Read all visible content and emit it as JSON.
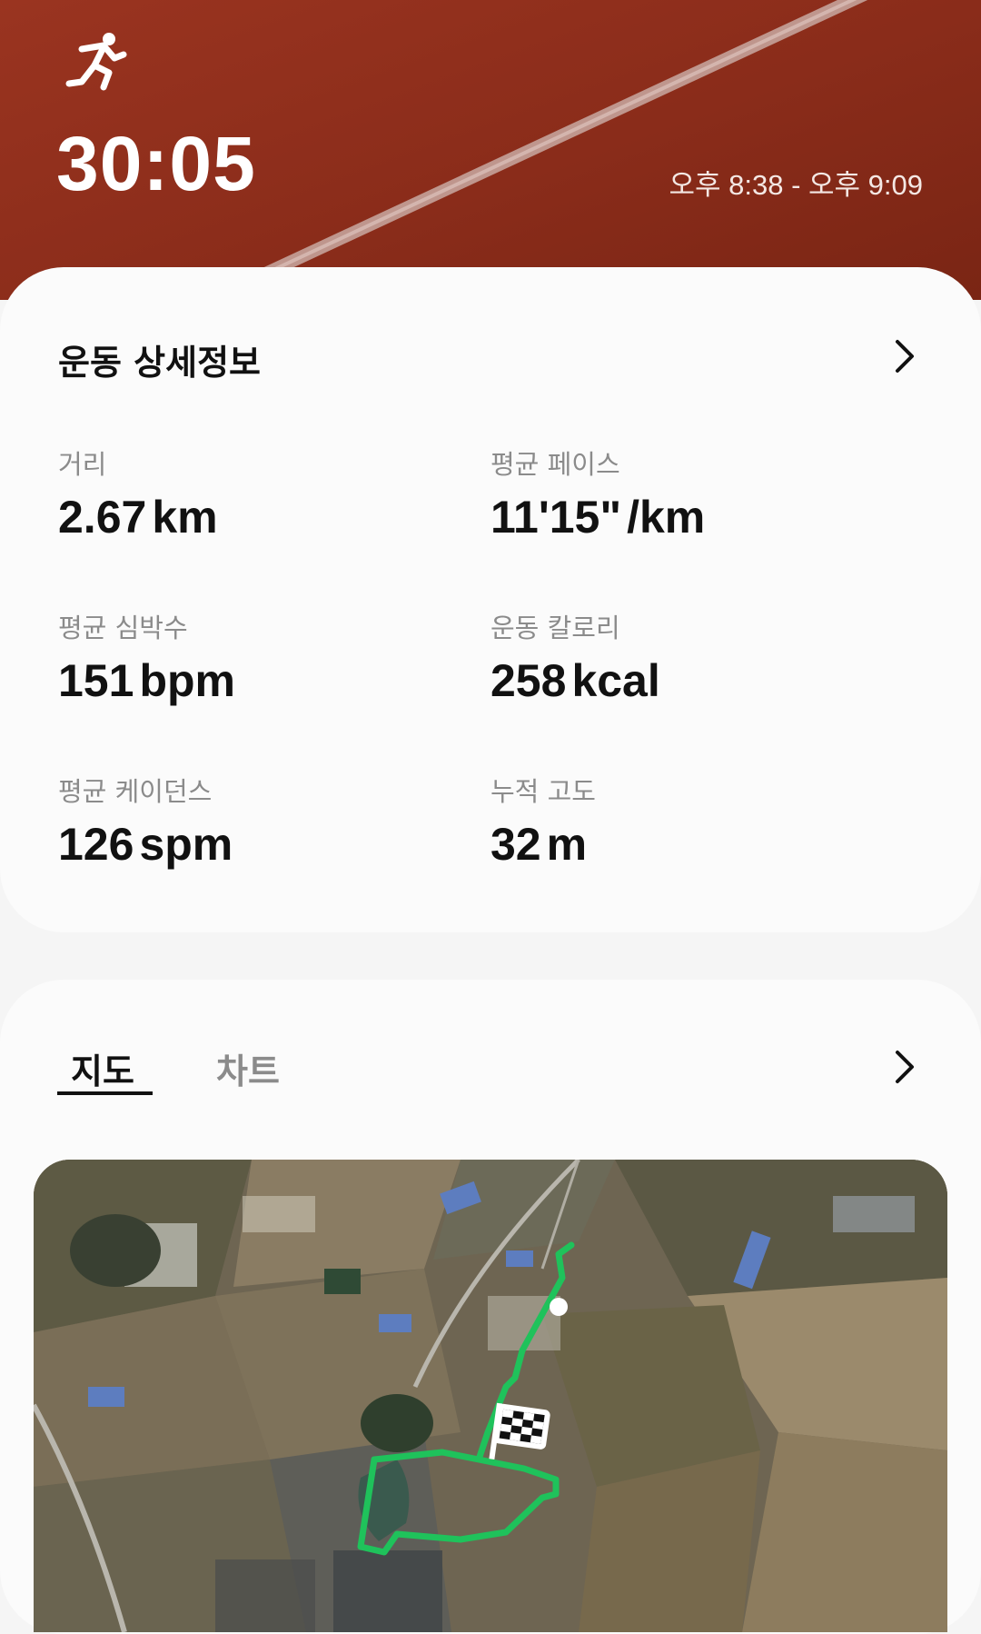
{
  "header": {
    "duration": "30:05",
    "time_range": "오후 8:38 - 오후 9:09",
    "icon": "running-person-icon",
    "background_color": "#8e2e1b"
  },
  "details": {
    "title": "운동 상세정보",
    "stats": [
      {
        "label": "거리",
        "value": "2.67",
        "unit": "km"
      },
      {
        "label": "평균 페이스",
        "value": "11'15\"",
        "unit": "/km"
      },
      {
        "label": "평균 심박수",
        "value": "151",
        "unit": "bpm"
      },
      {
        "label": "운동 칼로리",
        "value": "258",
        "unit": "kcal"
      },
      {
        "label": "평균 케이던스",
        "value": "126",
        "unit": "spm"
      },
      {
        "label": "누적 고도",
        "value": "32",
        "unit": "m"
      }
    ]
  },
  "tabs": {
    "map": "지도",
    "chart": "차트"
  },
  "map": {
    "route_color": "#1fc25b",
    "finish_icon": "checkered-flag-icon"
  }
}
